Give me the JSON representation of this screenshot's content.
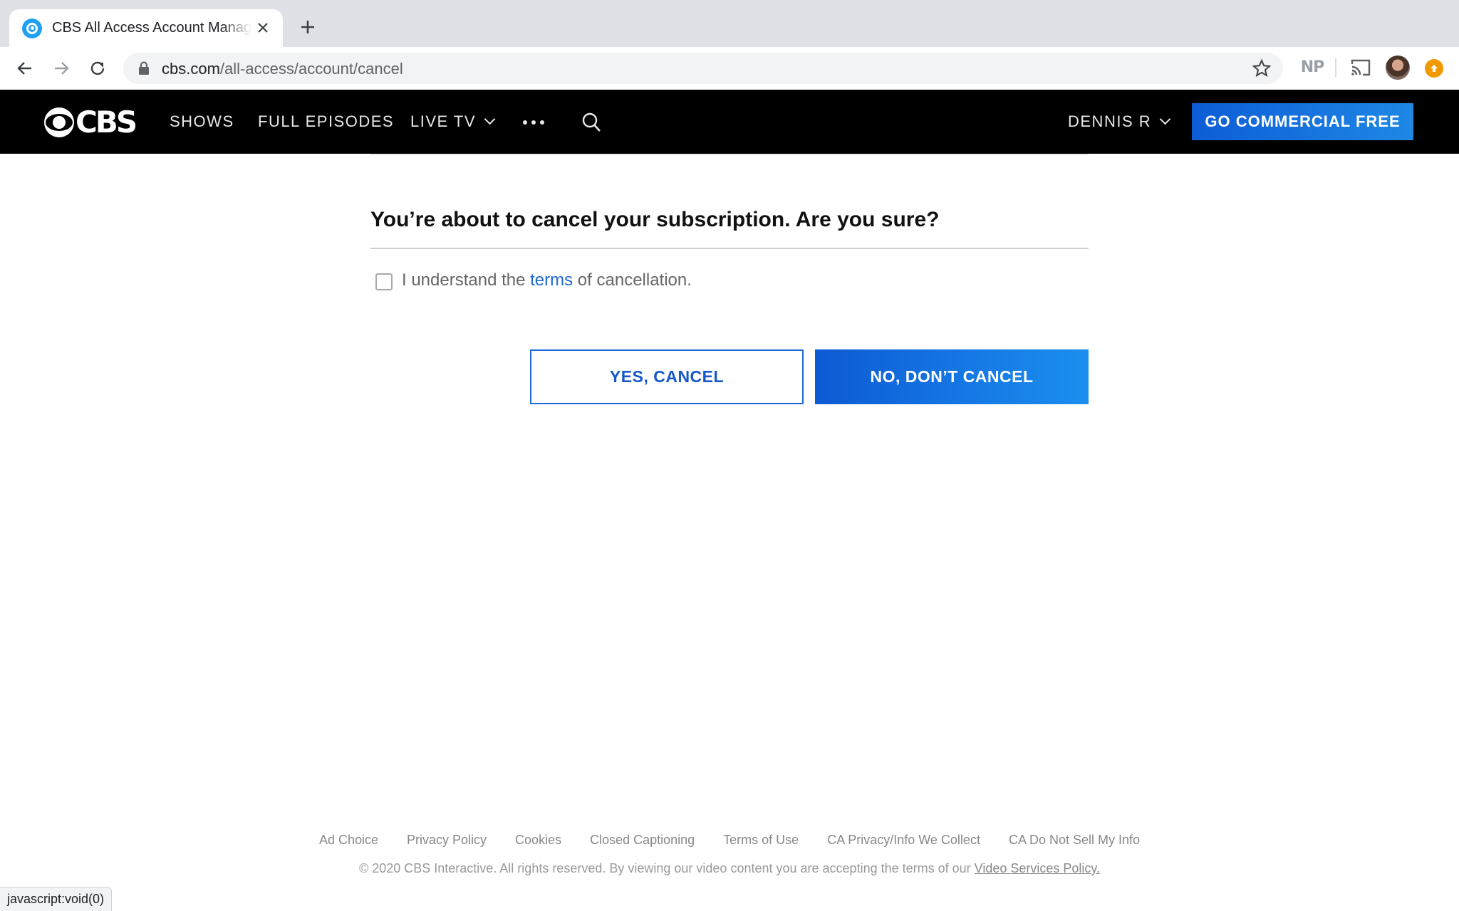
{
  "browser": {
    "tab_title": "CBS All Access Account Management",
    "url_host": "cbs.com",
    "url_path": "/all-access/account/cancel",
    "extension_label": "NP",
    "status_text": "javascript:void(0)"
  },
  "header": {
    "logo_text": "CBS",
    "nav": [
      {
        "label": "SHOWS"
      },
      {
        "label": "FULL EPISODES"
      },
      {
        "label": "LIVE TV"
      }
    ],
    "user_label": "DENNIS R",
    "cta_label": "GO COMMERCIAL FREE"
  },
  "main": {
    "heading": "You’re about to cancel your subscription. Are you sure?",
    "checkbox_prefix": "I understand the ",
    "checkbox_link": "terms",
    "checkbox_suffix": " of cancellation.",
    "yes_button": "YES, CANCEL",
    "no_button": "NO, DON’T CANCEL"
  },
  "footer": {
    "links": [
      {
        "label": "Ad Choice"
      },
      {
        "label": "Privacy Policy"
      },
      {
        "label": "Cookies"
      },
      {
        "label": "Closed Captioning"
      },
      {
        "label": "Terms of Use"
      },
      {
        "label": "CA Privacy/Info We Collect"
      },
      {
        "label": "CA Do Not Sell My Info"
      }
    ],
    "copyright": "© 2020 CBS Interactive. All rights reserved. By viewing our video content you are accepting the terms of our ",
    "policy_link": "Video Services Policy."
  },
  "colors": {
    "brand_blue": "#1e6ad6",
    "header_bg": "#000000",
    "link_blue": "#1f6bd1"
  }
}
